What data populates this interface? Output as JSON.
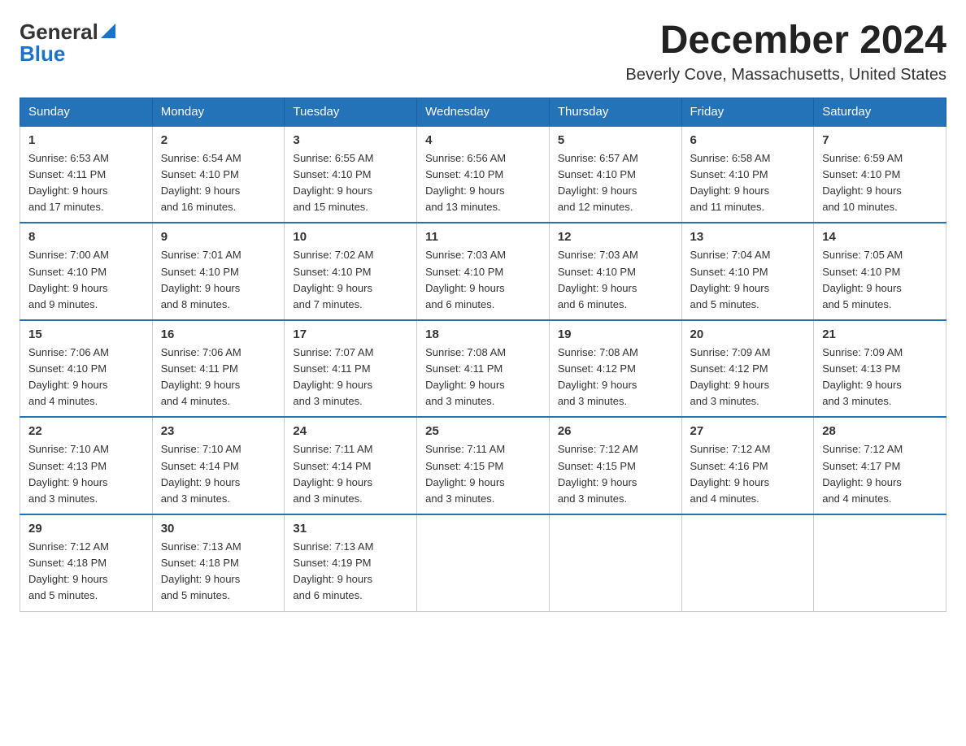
{
  "logo": {
    "general": "General",
    "blue": "Blue"
  },
  "title": "December 2024",
  "location": "Beverly Cove, Massachusetts, United States",
  "days_of_week": [
    "Sunday",
    "Monday",
    "Tuesday",
    "Wednesday",
    "Thursday",
    "Friday",
    "Saturday"
  ],
  "weeks": [
    [
      {
        "day": "1",
        "sunrise": "6:53 AM",
        "sunset": "4:11 PM",
        "daylight": "9 hours and 17 minutes."
      },
      {
        "day": "2",
        "sunrise": "6:54 AM",
        "sunset": "4:10 PM",
        "daylight": "9 hours and 16 minutes."
      },
      {
        "day": "3",
        "sunrise": "6:55 AM",
        "sunset": "4:10 PM",
        "daylight": "9 hours and 15 minutes."
      },
      {
        "day": "4",
        "sunrise": "6:56 AM",
        "sunset": "4:10 PM",
        "daylight": "9 hours and 13 minutes."
      },
      {
        "day": "5",
        "sunrise": "6:57 AM",
        "sunset": "4:10 PM",
        "daylight": "9 hours and 12 minutes."
      },
      {
        "day": "6",
        "sunrise": "6:58 AM",
        "sunset": "4:10 PM",
        "daylight": "9 hours and 11 minutes."
      },
      {
        "day": "7",
        "sunrise": "6:59 AM",
        "sunset": "4:10 PM",
        "daylight": "9 hours and 10 minutes."
      }
    ],
    [
      {
        "day": "8",
        "sunrise": "7:00 AM",
        "sunset": "4:10 PM",
        "daylight": "9 hours and 9 minutes."
      },
      {
        "day": "9",
        "sunrise": "7:01 AM",
        "sunset": "4:10 PM",
        "daylight": "9 hours and 8 minutes."
      },
      {
        "day": "10",
        "sunrise": "7:02 AM",
        "sunset": "4:10 PM",
        "daylight": "9 hours and 7 minutes."
      },
      {
        "day": "11",
        "sunrise": "7:03 AM",
        "sunset": "4:10 PM",
        "daylight": "9 hours and 6 minutes."
      },
      {
        "day": "12",
        "sunrise": "7:03 AM",
        "sunset": "4:10 PM",
        "daylight": "9 hours and 6 minutes."
      },
      {
        "day": "13",
        "sunrise": "7:04 AM",
        "sunset": "4:10 PM",
        "daylight": "9 hours and 5 minutes."
      },
      {
        "day": "14",
        "sunrise": "7:05 AM",
        "sunset": "4:10 PM",
        "daylight": "9 hours and 5 minutes."
      }
    ],
    [
      {
        "day": "15",
        "sunrise": "7:06 AM",
        "sunset": "4:10 PM",
        "daylight": "9 hours and 4 minutes."
      },
      {
        "day": "16",
        "sunrise": "7:06 AM",
        "sunset": "4:11 PM",
        "daylight": "9 hours and 4 minutes."
      },
      {
        "day": "17",
        "sunrise": "7:07 AM",
        "sunset": "4:11 PM",
        "daylight": "9 hours and 3 minutes."
      },
      {
        "day": "18",
        "sunrise": "7:08 AM",
        "sunset": "4:11 PM",
        "daylight": "9 hours and 3 minutes."
      },
      {
        "day": "19",
        "sunrise": "7:08 AM",
        "sunset": "4:12 PM",
        "daylight": "9 hours and 3 minutes."
      },
      {
        "day": "20",
        "sunrise": "7:09 AM",
        "sunset": "4:12 PM",
        "daylight": "9 hours and 3 minutes."
      },
      {
        "day": "21",
        "sunrise": "7:09 AM",
        "sunset": "4:13 PM",
        "daylight": "9 hours and 3 minutes."
      }
    ],
    [
      {
        "day": "22",
        "sunrise": "7:10 AM",
        "sunset": "4:13 PM",
        "daylight": "9 hours and 3 minutes."
      },
      {
        "day": "23",
        "sunrise": "7:10 AM",
        "sunset": "4:14 PM",
        "daylight": "9 hours and 3 minutes."
      },
      {
        "day": "24",
        "sunrise": "7:11 AM",
        "sunset": "4:14 PM",
        "daylight": "9 hours and 3 minutes."
      },
      {
        "day": "25",
        "sunrise": "7:11 AM",
        "sunset": "4:15 PM",
        "daylight": "9 hours and 3 minutes."
      },
      {
        "day": "26",
        "sunrise": "7:12 AM",
        "sunset": "4:15 PM",
        "daylight": "9 hours and 3 minutes."
      },
      {
        "day": "27",
        "sunrise": "7:12 AM",
        "sunset": "4:16 PM",
        "daylight": "9 hours and 4 minutes."
      },
      {
        "day": "28",
        "sunrise": "7:12 AM",
        "sunset": "4:17 PM",
        "daylight": "9 hours and 4 minutes."
      }
    ],
    [
      {
        "day": "29",
        "sunrise": "7:12 AM",
        "sunset": "4:18 PM",
        "daylight": "9 hours and 5 minutes."
      },
      {
        "day": "30",
        "sunrise": "7:13 AM",
        "sunset": "4:18 PM",
        "daylight": "9 hours and 5 minutes."
      },
      {
        "day": "31",
        "sunrise": "7:13 AM",
        "sunset": "4:19 PM",
        "daylight": "9 hours and 6 minutes."
      },
      null,
      null,
      null,
      null
    ]
  ],
  "labels": {
    "sunrise": "Sunrise:",
    "sunset": "Sunset:",
    "daylight": "Daylight:"
  }
}
